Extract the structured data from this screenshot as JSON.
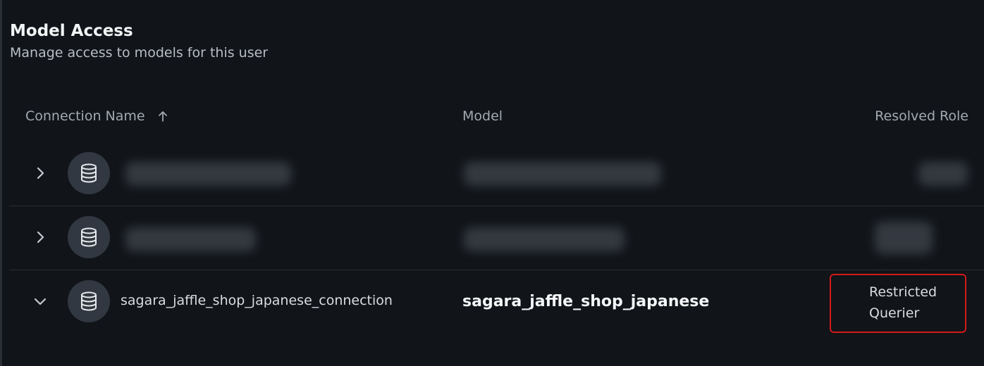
{
  "header": {
    "title": "Model Access",
    "subtitle": "Manage access to models for this user"
  },
  "table": {
    "columns": {
      "connection": "Connection Name",
      "model": "Model",
      "role": "Resolved Role"
    },
    "sort": {
      "column": "connection",
      "direction": "ascending",
      "icon": "arrow-up-icon"
    },
    "rows": [
      {
        "expanded": false,
        "icon": "database-icon",
        "redacted": true
      },
      {
        "expanded": false,
        "icon": "database-icon",
        "redacted": true
      },
      {
        "expanded": true,
        "icon": "database-icon",
        "connection": "sagara_jaffle_shop_japanese_connection",
        "model": "sagara_jaffle_shop_japanese",
        "role": "Restricted Querier",
        "role_highlight_color": "#d31a1a"
      }
    ]
  }
}
